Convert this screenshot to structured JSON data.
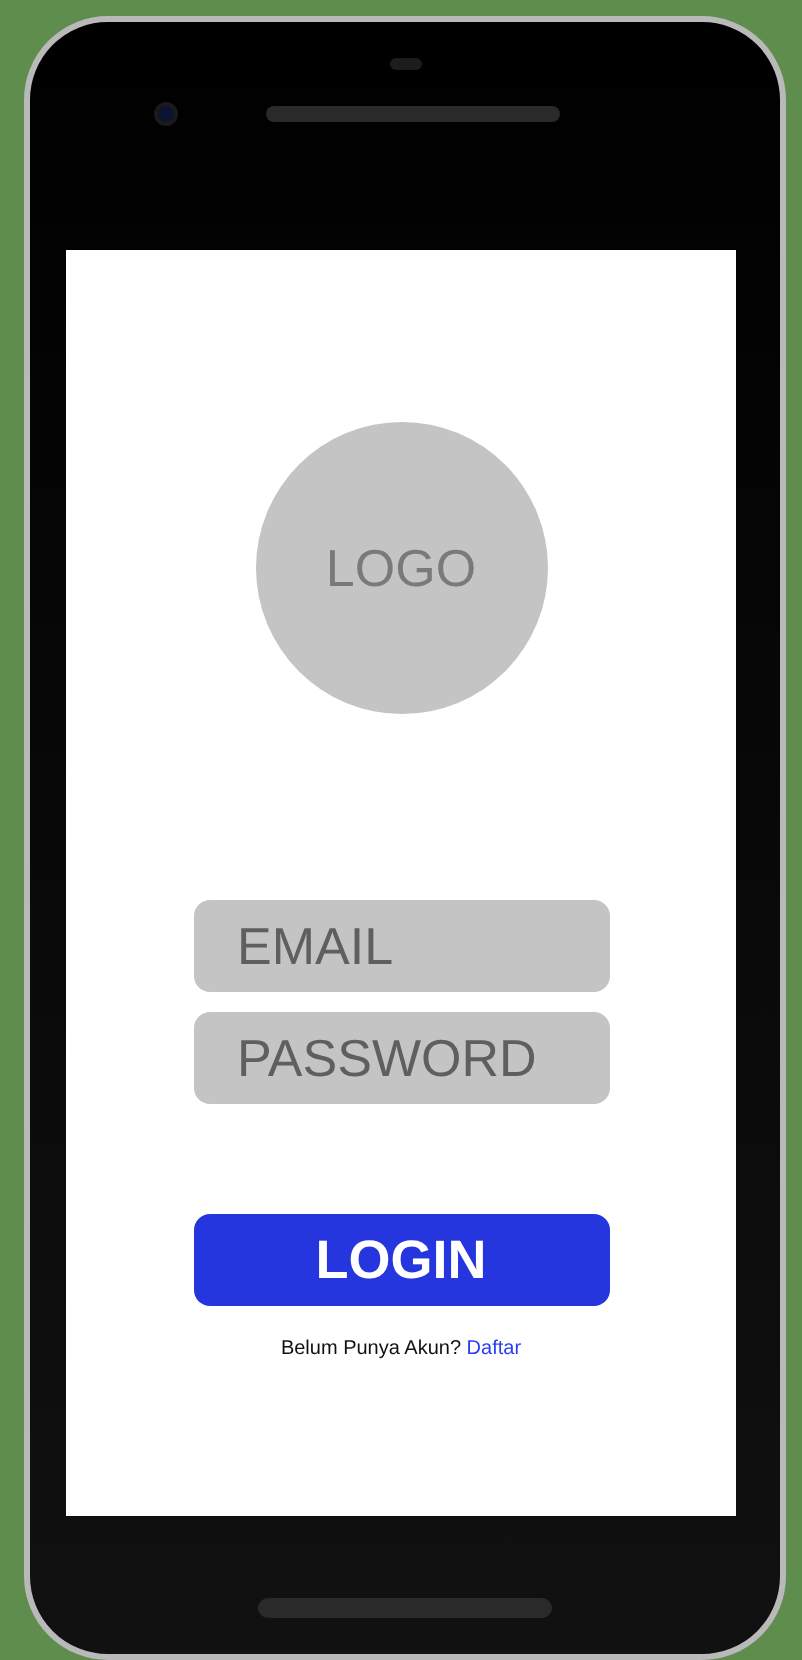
{
  "logo": {
    "text": "LOGO"
  },
  "fields": [
    {
      "placeholder": "EMAIL"
    },
    {
      "placeholder": "PASSWORD"
    }
  ],
  "login_button": {
    "label": "LOGIN"
  },
  "signup_prompt": {
    "text": "Belum Punya Akun?",
    "link": "Daftar"
  }
}
